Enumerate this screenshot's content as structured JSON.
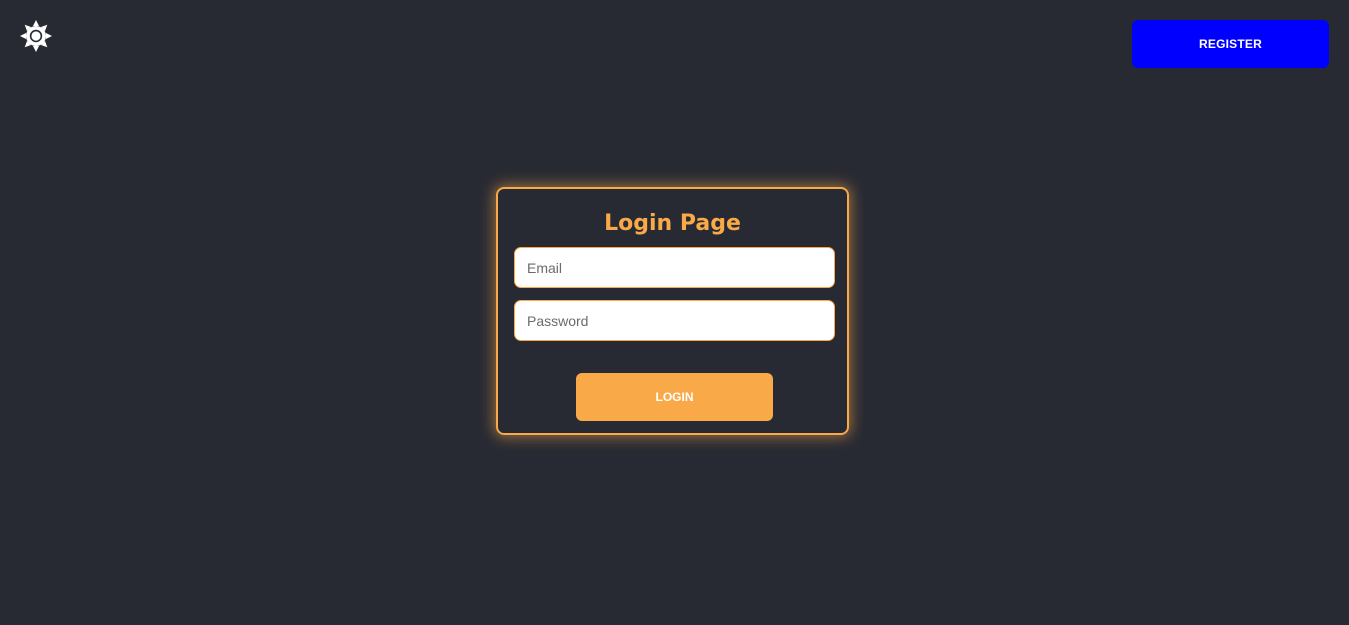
{
  "header": {
    "theme_toggle_icon": "sun-icon",
    "register_label": "REGISTER"
  },
  "login": {
    "title": "Login Page",
    "email_placeholder": "Email",
    "email_value": "",
    "password_placeholder": "Password",
    "password_value": "",
    "login_label": "LOGIN"
  },
  "colors": {
    "background": "#282a33",
    "accent": "#f9a947",
    "register_button": "#0000ff",
    "icon": "#ffffff"
  }
}
